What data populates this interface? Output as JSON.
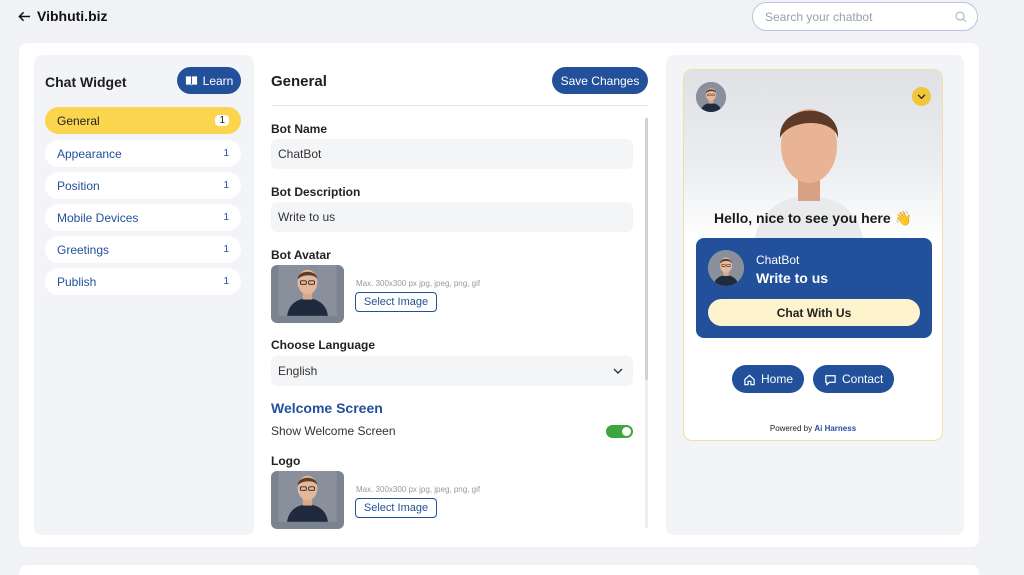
{
  "header": {
    "back_label": "Vibhuti.biz",
    "search_placeholder": "Search your chatbot"
  },
  "sidebar": {
    "title": "Chat Widget",
    "learn_label": "Learn",
    "items": [
      {
        "label": "General",
        "count": "1"
      },
      {
        "label": "Appearance",
        "count": "1"
      },
      {
        "label": "Position",
        "count": "1"
      },
      {
        "label": "Mobile Devices",
        "count": "1"
      },
      {
        "label": "Greetings",
        "count": "1"
      },
      {
        "label": "Publish",
        "count": "1"
      }
    ]
  },
  "general": {
    "title": "General",
    "save_label": "Save Changes",
    "bot_name_label": "Bot Name",
    "bot_name_value": "ChatBot",
    "bot_desc_label": "Bot Description",
    "bot_desc_value": "Write to us",
    "bot_avatar_label": "Bot Avatar",
    "image_hint": "Max. 300x300 px jpg, jpeg, png, gif",
    "select_image_label": "Select Image",
    "language_label": "Choose Language",
    "language_value": "English",
    "welcome_title": "Welcome Screen",
    "show_welcome_label": "Show Welcome Screen",
    "show_welcome_enabled": true,
    "logo_label": "Logo"
  },
  "preview": {
    "greeting": "Hello, nice to see you here 👋",
    "bot_name": "ChatBot",
    "bot_desc": "Write to us",
    "chat_button": "Chat With Us",
    "home_label": "Home",
    "contact_label": "Contact",
    "powered_prefix": "Powered by",
    "powered_brand": "Ai Harness"
  },
  "colors": {
    "primary": "#23509b",
    "accent": "#fad54d",
    "toggle_on": "#3ea63e"
  },
  "icons": [
    "back-arrow-icon",
    "search-icon",
    "book-icon",
    "chevron-down-icon",
    "home-icon",
    "chat-bubble-icon"
  ]
}
